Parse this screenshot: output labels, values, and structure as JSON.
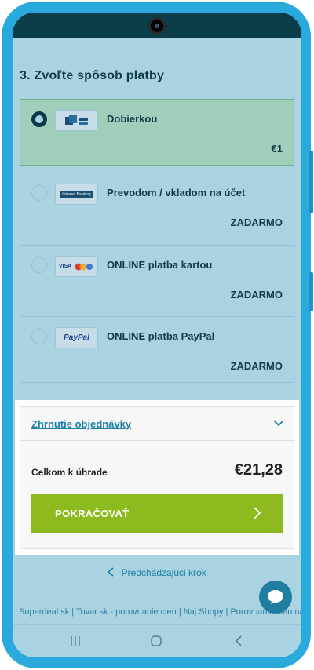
{
  "section_title": "3. Zvoľte spôsob platby",
  "payment_options": [
    {
      "name": "Dobierkou",
      "price": "€1",
      "selected": true,
      "logo": "cash-on-delivery-icon"
    },
    {
      "name": "Prevodom / vkladom na účet",
      "price": "ZADARMO",
      "selected": false,
      "logo": "internet-banking-logo",
      "logo_text": "Internet Banking"
    },
    {
      "name": "ONLINE platba kartou",
      "price": "ZADARMO",
      "selected": false,
      "logo": "card-logos",
      "logo_text": "VISA"
    },
    {
      "name": "ONLINE platba PayPal",
      "price": "ZADARMO",
      "selected": false,
      "logo": "paypal-logo",
      "logo_text": "PayPal"
    }
  ],
  "summary": {
    "toggle_label": "Zhrnutie objednávky",
    "total_label": "Celkom k úhrade",
    "total_value": "€21,28",
    "continue_label": "POKRAČOVAŤ"
  },
  "previous_step_label": "Predchádzajúci krok",
  "footer_links": "Superdeal.sk | Tovar.sk - porovnanie cien | Naj Shopy | Porovnanie cien na",
  "colors": {
    "accent_green": "#8dbb1f",
    "link_blue": "#1a7fa6",
    "frame_blue": "#2aaadc",
    "text_dark": "#103b4a"
  }
}
